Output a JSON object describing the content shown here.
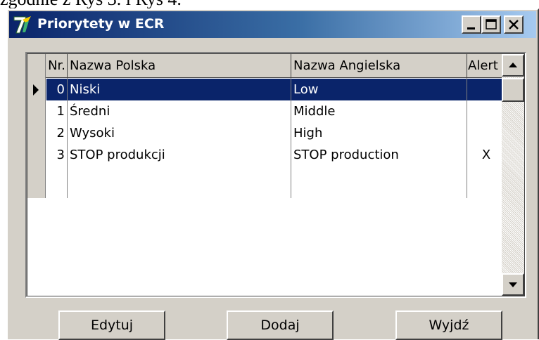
{
  "caption": "zgodnie z Rys 3. i Rys 4.",
  "window": {
    "title": "Priorytety w ECR"
  },
  "grid": {
    "columns": [
      "Nr.",
      "Nazwa Polska",
      "Nazwa Angielska",
      "Alert"
    ],
    "rows": [
      {
        "nr": "0",
        "pl": "Niski",
        "en": "Low",
        "alert": "",
        "selected": true
      },
      {
        "nr": "1",
        "pl": "Średni",
        "en": "Middle",
        "alert": ""
      },
      {
        "nr": "2",
        "pl": "Wysoki",
        "en": "High",
        "alert": ""
      },
      {
        "nr": "3",
        "pl": "STOP produkcji",
        "en": "STOP production",
        "alert": "X"
      }
    ]
  },
  "buttons": {
    "edit": "Edytuj",
    "add": "Dodaj",
    "exit": "Wyjdź"
  },
  "colors": {
    "titlebar_start": "#0a246a",
    "titlebar_end": "#a6caf0",
    "selection": "#0a246a",
    "face": "#d4d0c8"
  }
}
